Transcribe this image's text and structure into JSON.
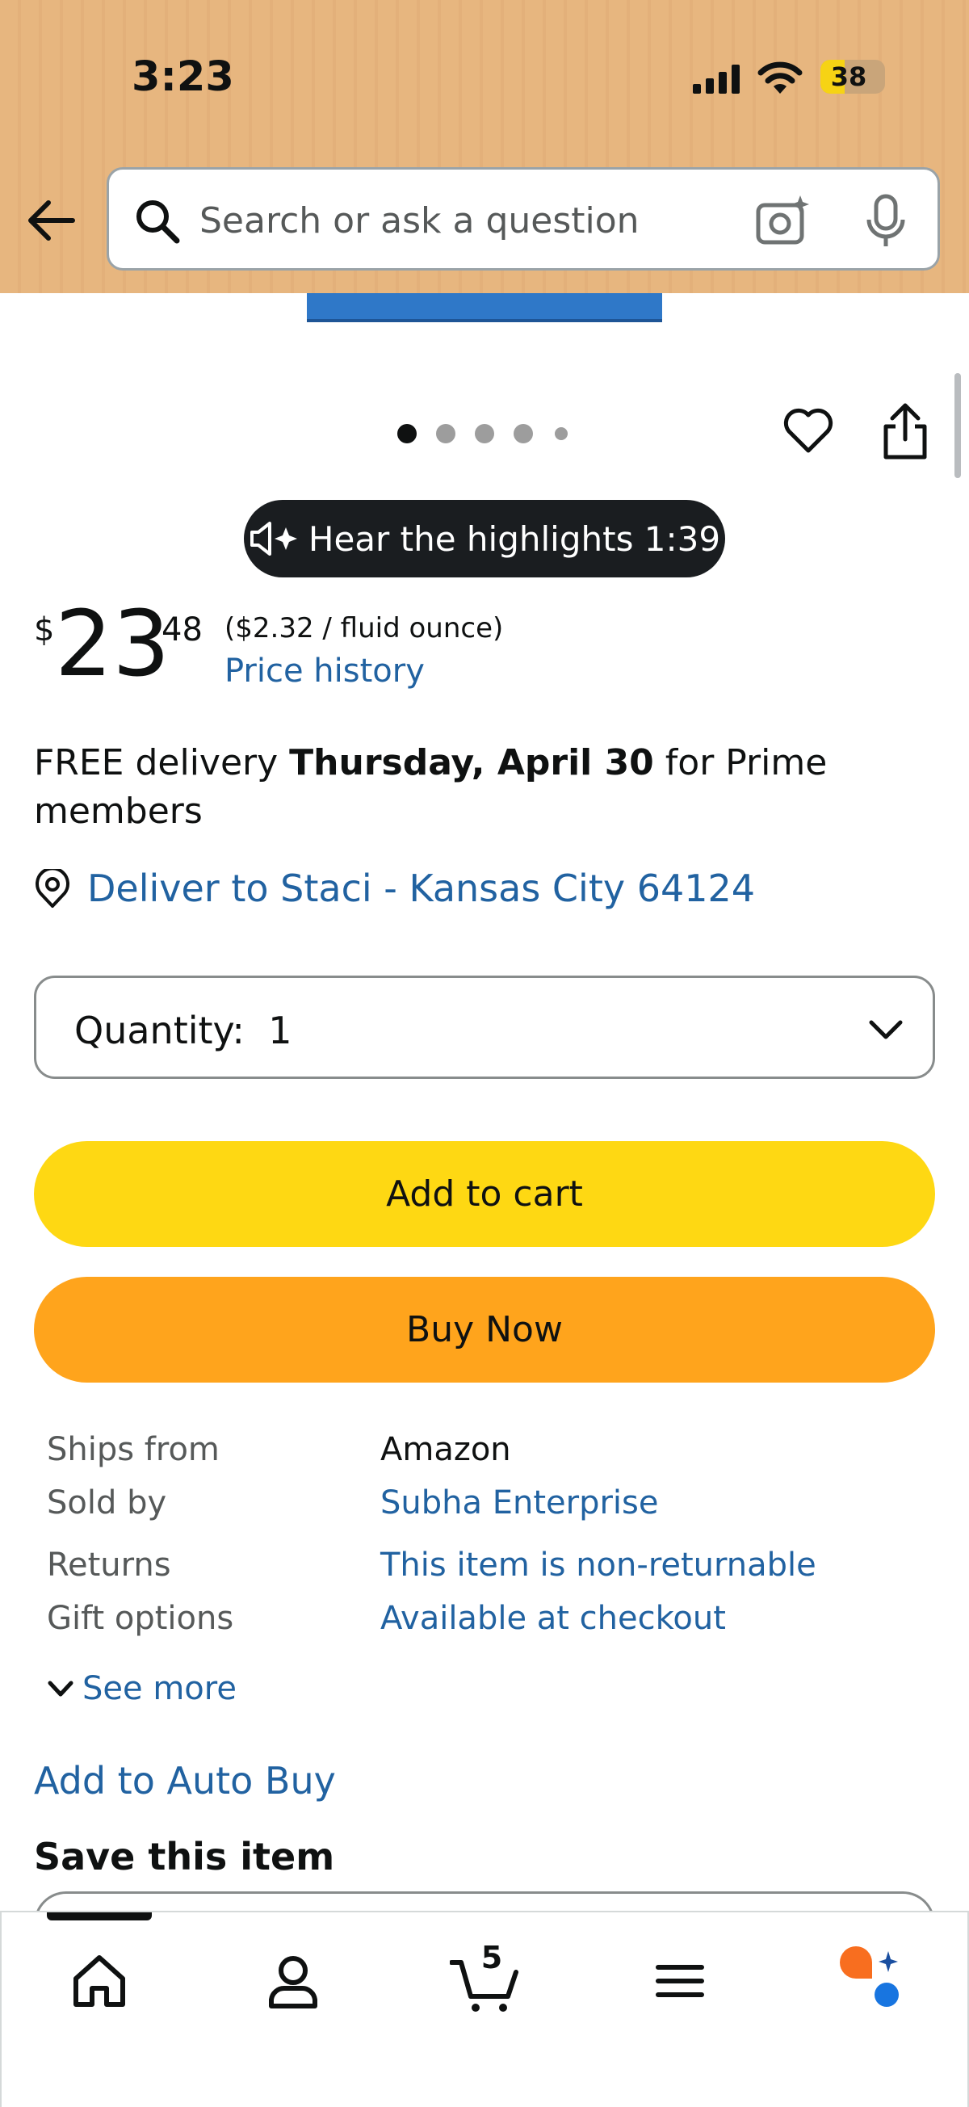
{
  "status_bar": {
    "time": "3:23",
    "battery": "38",
    "battery_level_percent": 38,
    "icons": [
      "cellular-signal-icon",
      "wifi-icon",
      "battery-icon"
    ]
  },
  "search": {
    "placeholder": "Search or ask a question",
    "icons": [
      "back-arrow-icon",
      "search-icon",
      "camera-search-icon",
      "microphone-icon"
    ]
  },
  "gallery": {
    "image_count": 5,
    "active_index": 0,
    "actions": [
      "heart-icon",
      "share-icon"
    ]
  },
  "audio_summary": {
    "label": "Hear the highlights 1:39",
    "icon": "speaker-sparkle-icon"
  },
  "price": {
    "symbol": "$",
    "whole": "23",
    "fraction": "48",
    "unit_price": "($2.32 / fluid ounce)",
    "history_link": "Price history"
  },
  "delivery": {
    "prefix": "FREE delivery ",
    "date": "Thursday, April 30",
    "suffix": " for Prime members",
    "deliver_to": "Deliver to Staci - Kansas City 64124"
  },
  "quantity": {
    "label": "Quantity:",
    "value": "1"
  },
  "buttons": {
    "add_to_cart": "Add to cart",
    "buy_now": "Buy Now"
  },
  "details": [
    {
      "label": "Ships from",
      "value": "Amazon",
      "link": false
    },
    {
      "label": "Sold by",
      "value": "Subha Enterprise",
      "link": true
    },
    {
      "label": "Returns",
      "value": "This item is non-returnable",
      "link": true
    },
    {
      "label": "Gift options",
      "value": "Available at checkout",
      "link": true
    }
  ],
  "see_more": "See more",
  "auto_buy": "Add to Auto Buy",
  "save_item": "Save this item",
  "bottom_nav": {
    "items": [
      "home-icon",
      "account-icon",
      "cart-icon",
      "menu-icon",
      "rufus-assistant-icon"
    ],
    "cart_count": "5"
  },
  "colors": {
    "header_bg": "#e7b67f",
    "link": "#2162a1",
    "add_to_cart": "#fed813",
    "buy_now": "#ffa41c",
    "highlights_pill": "#1a1d20"
  }
}
